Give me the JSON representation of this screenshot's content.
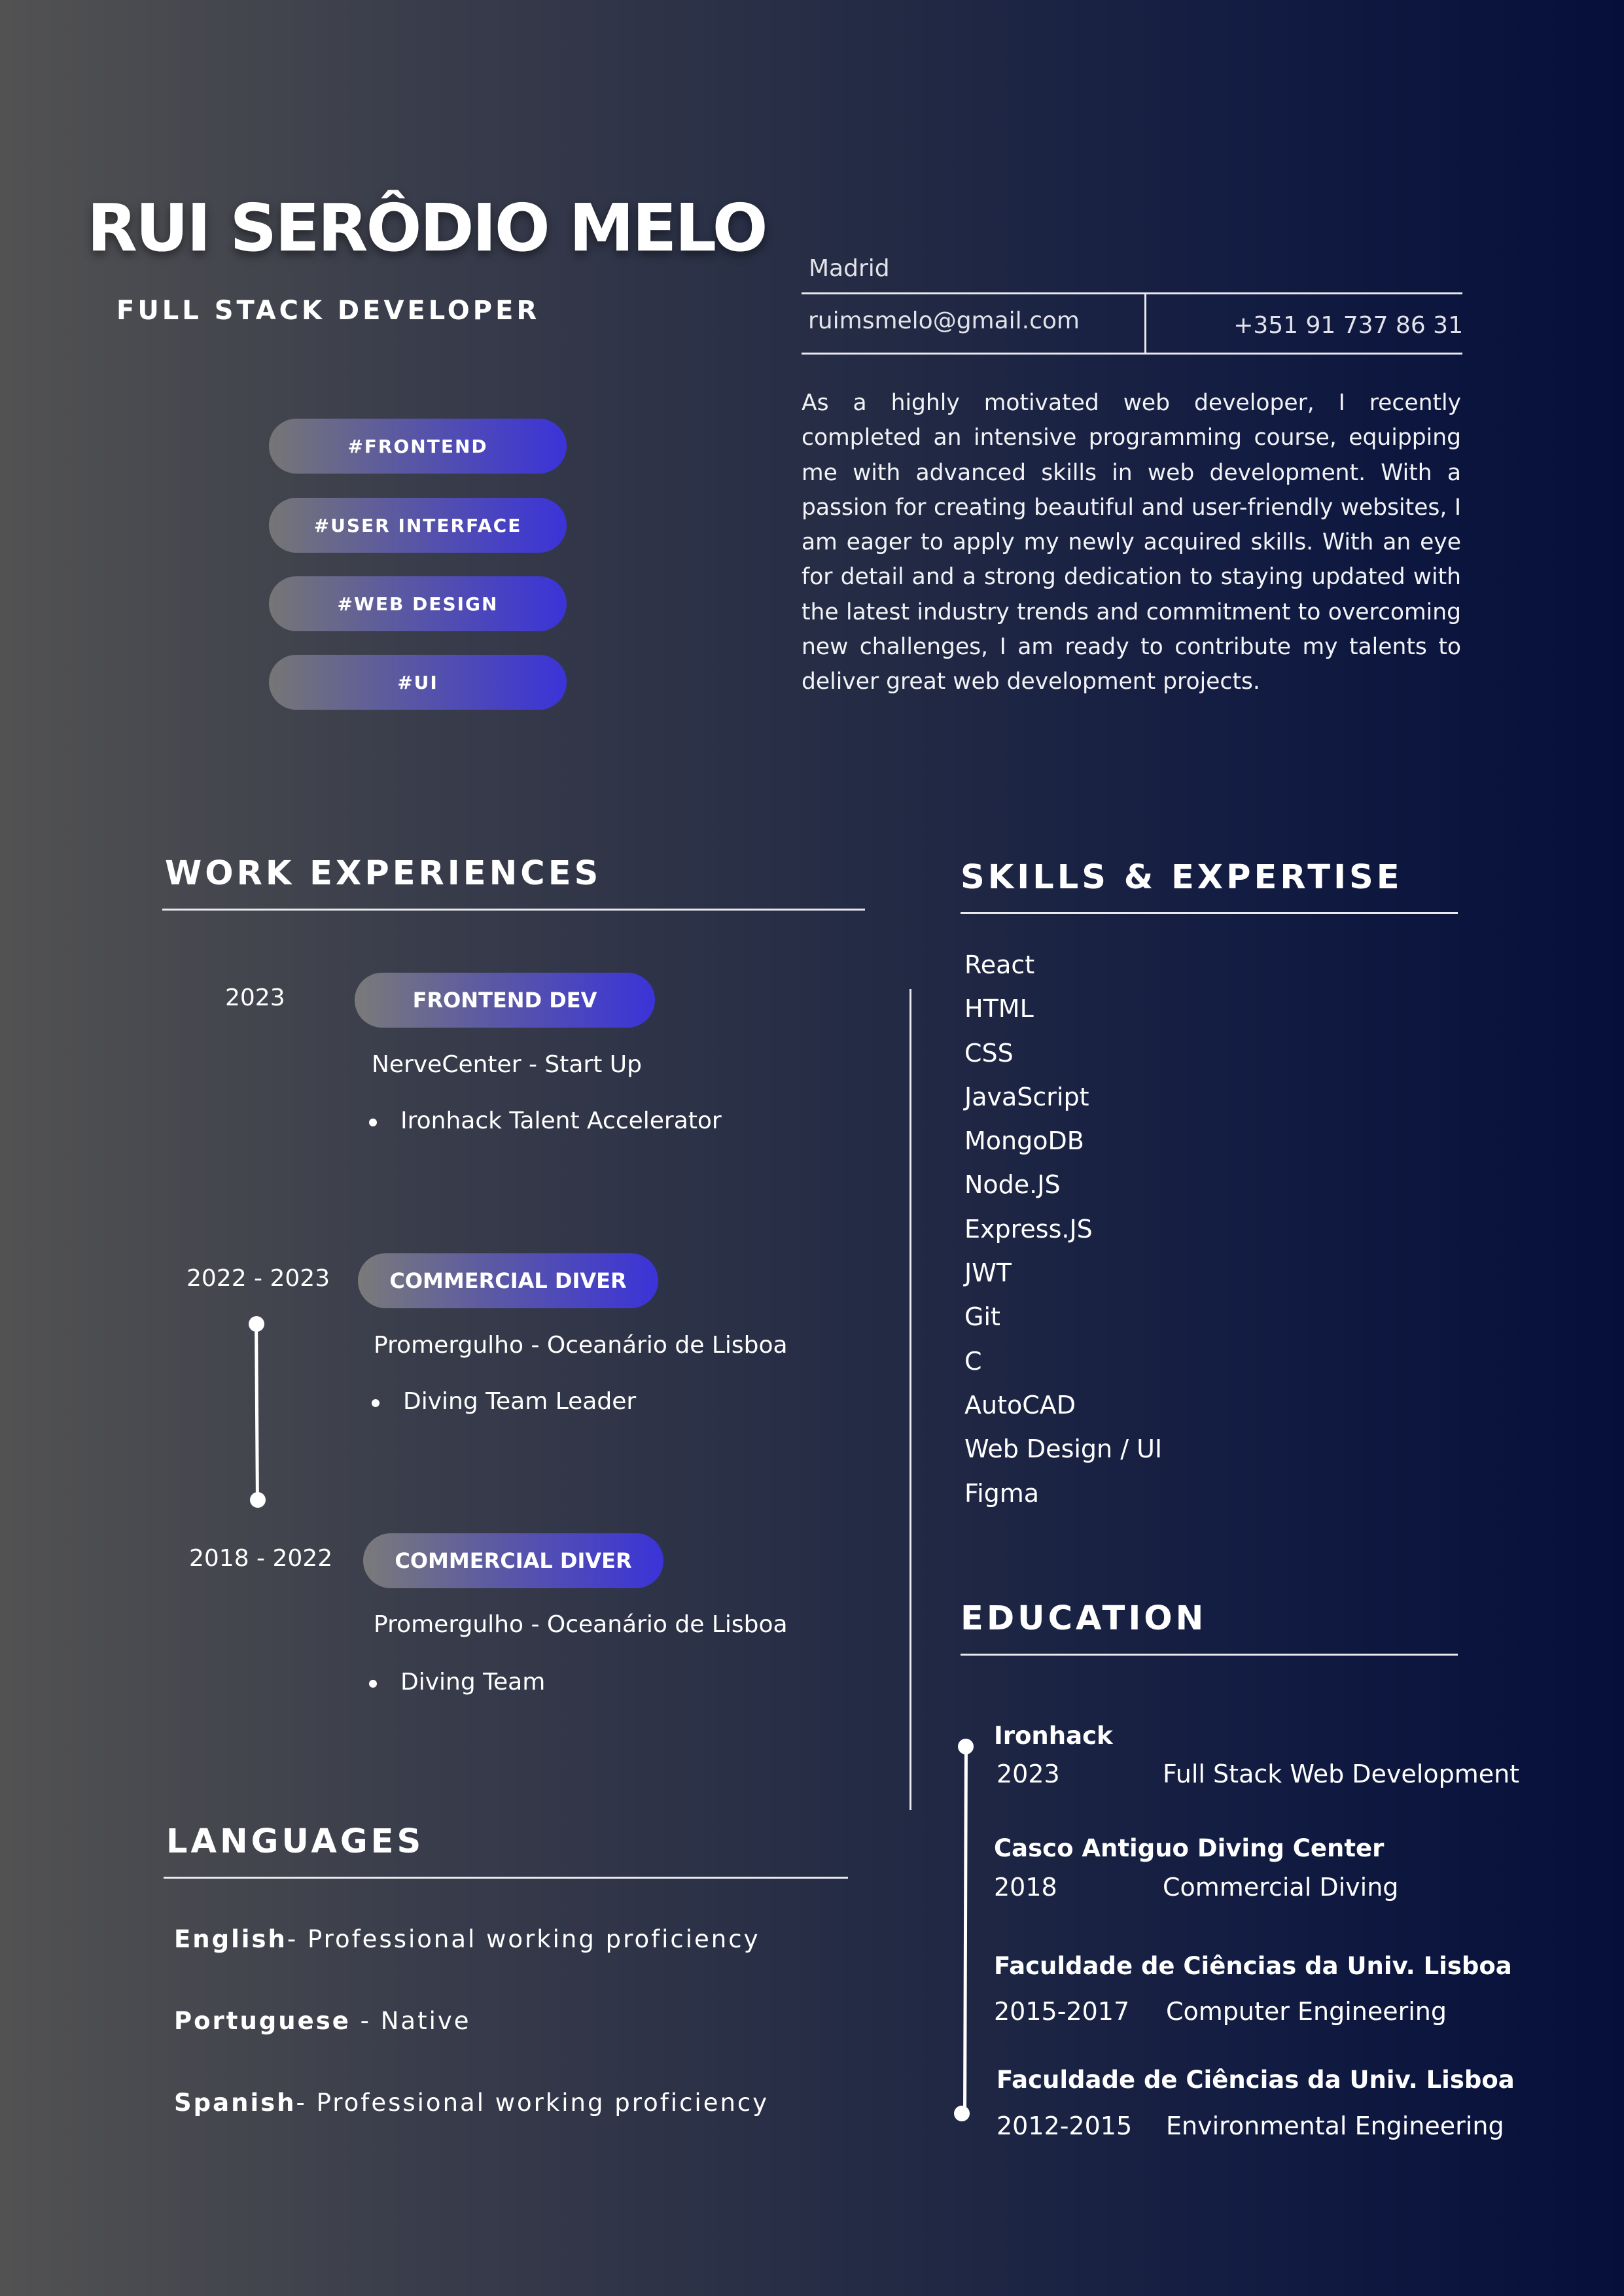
{
  "header": {
    "name": "RUI SERÔDIO MELO",
    "role": "FULL STACK DEVELOPER",
    "tags": [
      "#FRONTEND",
      "#USER INTERFACE",
      "#WEB DESIGN",
      "#UI"
    ]
  },
  "contact": {
    "city": "Madrid",
    "email": "ruimsmelo@gmail.com",
    "phone": "+351 91 737 86 31"
  },
  "summary": "As a highly motivated web developer, I recently completed an intensive programming course, equipping me with advanced skills in web development. With a passion for creating beautiful and user-friendly websites, I am eager to apply my newly acquired skills. With an eye for detail and a strong dedication to staying updated with the latest industry trends and commitment to overcoming new challenges, I am ready to contribute my talents to deliver great web development projects.",
  "work": {
    "title": "WORK EXPERIENCES",
    "items": [
      {
        "years": "2023",
        "role": "FRONTEND DEV",
        "company": "NerveCenter - Start Up",
        "bullet": "Ironhack Talent Accelerator"
      },
      {
        "years": "2022 - 2023",
        "role": "COMMERCIAL DIVER",
        "company": "Promergulho - Oceanário de Lisboa",
        "bullet": "Diving Team Leader"
      },
      {
        "years": "2018 - 2022",
        "role": "COMMERCIAL DIVER",
        "company": "Promergulho - Oceanário de Lisboa",
        "bullet": "Diving Team"
      }
    ]
  },
  "skills": {
    "title": "SKILLS & EXPERTISE",
    "items": [
      "React",
      "HTML",
      "CSS",
      "JavaScript",
      "MongoDB",
      "Node.JS",
      "Express.JS",
      "JWT",
      "Git",
      "C",
      "AutoCAD",
      "Web Design / UI",
      "Figma"
    ]
  },
  "languages": {
    "title": "LANGUAGES",
    "items": [
      {
        "name": "English",
        "level": "- Professional working proficiency"
      },
      {
        "name": "Portuguese",
        "level": " - Native"
      },
      {
        "name": "Spanish",
        "level": "- Professional working proficiency"
      }
    ]
  },
  "education": {
    "title": "EDUCATION",
    "items": [
      {
        "school": "Ironhack",
        "years": "2023",
        "degree": "Full Stack Web Development"
      },
      {
        "school": "Casco Antiguo Diving Center",
        "years": "2018",
        "degree": "Commercial Diving"
      },
      {
        "school": "Faculdade de Ciências da Univ. Lisboa",
        "years": "2015-2017",
        "degree": "Computer Engineering"
      },
      {
        "school": "Faculdade de Ciências da Univ. Lisboa",
        "years": "2012-2015",
        "degree": "Environmental Engineering"
      }
    ]
  }
}
